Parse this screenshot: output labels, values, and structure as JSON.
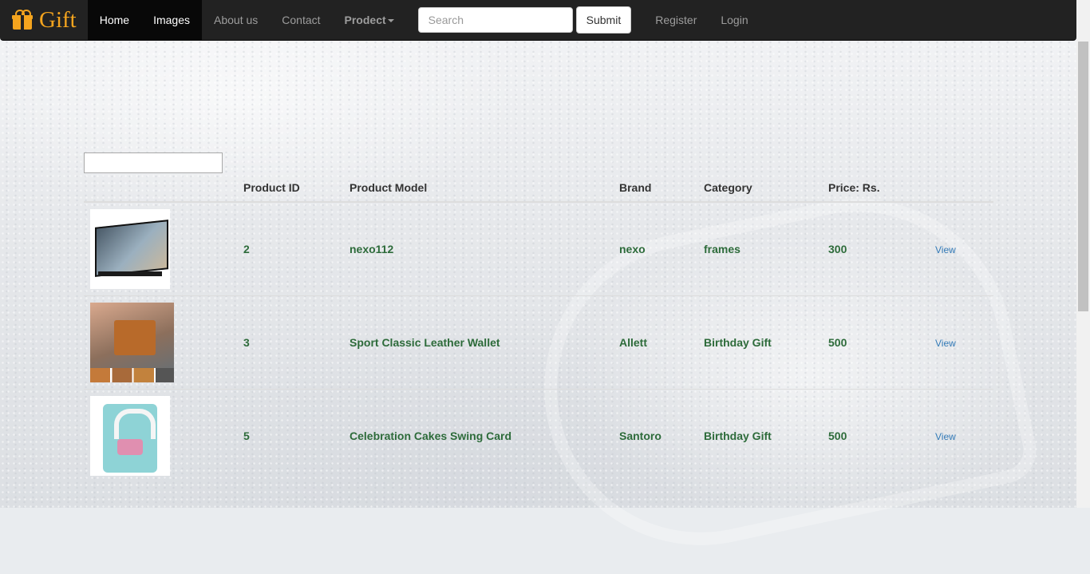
{
  "brand": {
    "name": "Gift"
  },
  "nav": {
    "home": "Home",
    "images": "Images",
    "about": "About us",
    "contact": "Contact",
    "product": "Prodect"
  },
  "search": {
    "placeholder": "Search",
    "value": "",
    "submit": "Submit"
  },
  "account": {
    "register": "Register",
    "login": "Login"
  },
  "filter": {
    "value": ""
  },
  "table": {
    "headers": [
      "",
      "Product ID",
      "Product Model",
      "Brand",
      "Category",
      "Price: Rs.",
      ""
    ],
    "rows": [
      {
        "image": "photo-frame-image",
        "id": "2",
        "model": "nexo112",
        "brand": "nexo",
        "category": "frames",
        "price": "300",
        "action": "View"
      },
      {
        "image": "leather-wallet-image",
        "id": "3",
        "model": "Sport Classic Leather Wallet",
        "brand": "Allett",
        "category": "Birthday Gift",
        "price": "500",
        "action": "View"
      },
      {
        "image": "cake-card-image",
        "id": "5",
        "model": "Celebration Cakes Swing Card",
        "brand": "Santoro",
        "category": "Birthday Gift",
        "price": "500",
        "action": "View"
      }
    ]
  },
  "colors": {
    "navbar": "#222222",
    "brand": "#f4a41e",
    "cell_text": "#2d6b3a",
    "link": "#337ab7"
  }
}
